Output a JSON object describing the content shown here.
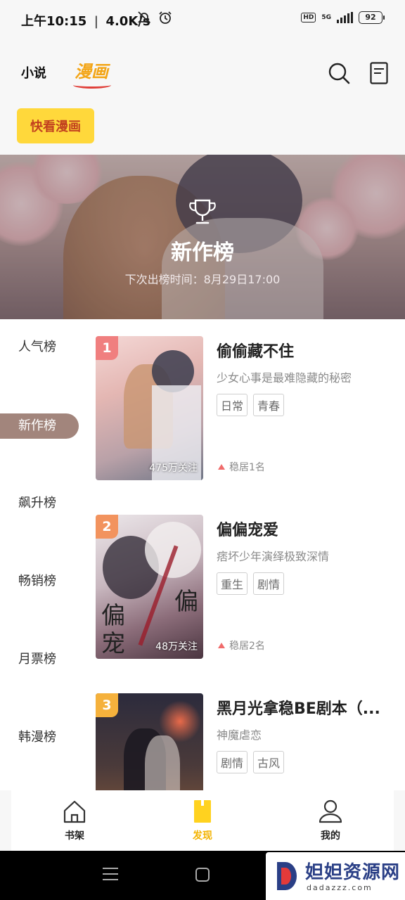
{
  "status_bar": {
    "time": "上午10:15",
    "speed": "4.0K/s",
    "hd": "HD",
    "network": "5G",
    "battery": "92"
  },
  "header": {
    "tab_novel": "小说",
    "tab_comic": "漫画",
    "quick_button": "快看漫画"
  },
  "banner": {
    "title": "新作榜",
    "subtitle": "下次出榜时间：8月29日17:00"
  },
  "categories": [
    "人气榜",
    "新作榜",
    "飙升榜",
    "畅销榜",
    "月票榜",
    "韩漫榜"
  ],
  "active_category": "新作榜",
  "items": [
    {
      "rank": "1",
      "title": "偷偷藏不住",
      "desc": "少女心事是最难隐藏的秘密",
      "tags": [
        "日常",
        "青春"
      ],
      "fans": "475万关注",
      "status": "稳居1名",
      "badge_color": "#f07f7f"
    },
    {
      "rank": "2",
      "title": "偏偏宠爱",
      "desc": "痞坏少年演绎极致深情",
      "tags": [
        "重生",
        "剧情"
      ],
      "fans": "48万关注",
      "status": "稳居2名",
      "badge_color": "#f2935e"
    },
    {
      "rank": "3",
      "title": "黑月光拿稳BE剧本（...",
      "desc": "神魔虐恋",
      "tags": [
        "剧情",
        "古风"
      ],
      "fans": "",
      "status": "",
      "badge_color": "#f5b13c"
    }
  ],
  "bottom_nav": {
    "shelf": "书架",
    "discover": "发现",
    "mine": "我的"
  },
  "watermark": {
    "title": "妲妲资源网",
    "url": "dadazzz.com"
  }
}
